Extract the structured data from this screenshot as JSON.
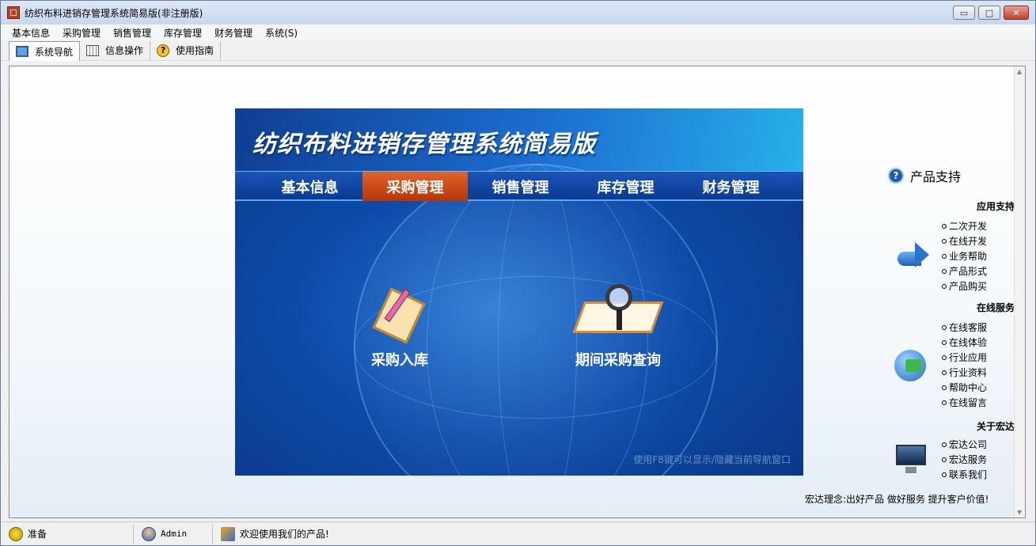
{
  "window": {
    "title": "纺织布料进销存管理系统简易版(非注册版)",
    "controls": {
      "minimize": "▭",
      "maximize": "□",
      "close": "✕"
    }
  },
  "menu": [
    "基本信息",
    "采购管理",
    "销售管理",
    "库存管理",
    "财务管理",
    "系统(S)"
  ],
  "toolbar": [
    {
      "label": "系统导航",
      "icon": "monitor-icon",
      "active": true
    },
    {
      "label": "信息操作",
      "icon": "grid-icon",
      "active": false
    },
    {
      "label": "使用指南",
      "icon": "help-icon",
      "active": false
    }
  ],
  "panel": {
    "title": "纺织布料进销存管理系统简易版",
    "tabs": [
      "基本信息",
      "采购管理",
      "销售管理",
      "库存管理",
      "财务管理"
    ],
    "selected_tab": "采购管理",
    "items": [
      {
        "label": "采购入库",
        "icon": "clipboard-icon"
      },
      {
        "label": "期间采购查询",
        "icon": "magnifier-book-icon"
      }
    ],
    "hint": "使用F8键可以显示/隐藏当前导航窗口"
  },
  "support": {
    "title": "产品支持",
    "sections": [
      {
        "title": "应用支持",
        "icon": "arrow-icon",
        "links": [
          "二次开发",
          "在线开发",
          "业务帮助",
          "产品形式",
          "产品购买"
        ]
      },
      {
        "title": "在线服务",
        "icon": "globe-icon",
        "links": [
          "在线客服",
          "在线体验",
          "行业应用",
          "行业资料",
          "帮助中心",
          "在线留言"
        ]
      },
      {
        "title": "关于宏达",
        "icon": "monitor-icon",
        "links": [
          "宏达公司",
          "宏达服务",
          "联系我们"
        ]
      }
    ],
    "motto": "宏达理念:出好产品 做好服务 提升客户价值!"
  },
  "statusbar": {
    "status": "准备",
    "user": "Admin",
    "message": "欢迎使用我们的产品!"
  },
  "colors": {
    "accent_tab": "#c84a16",
    "panel_blue": "#0d4aa8",
    "nav_blue": "#1b54b8"
  }
}
